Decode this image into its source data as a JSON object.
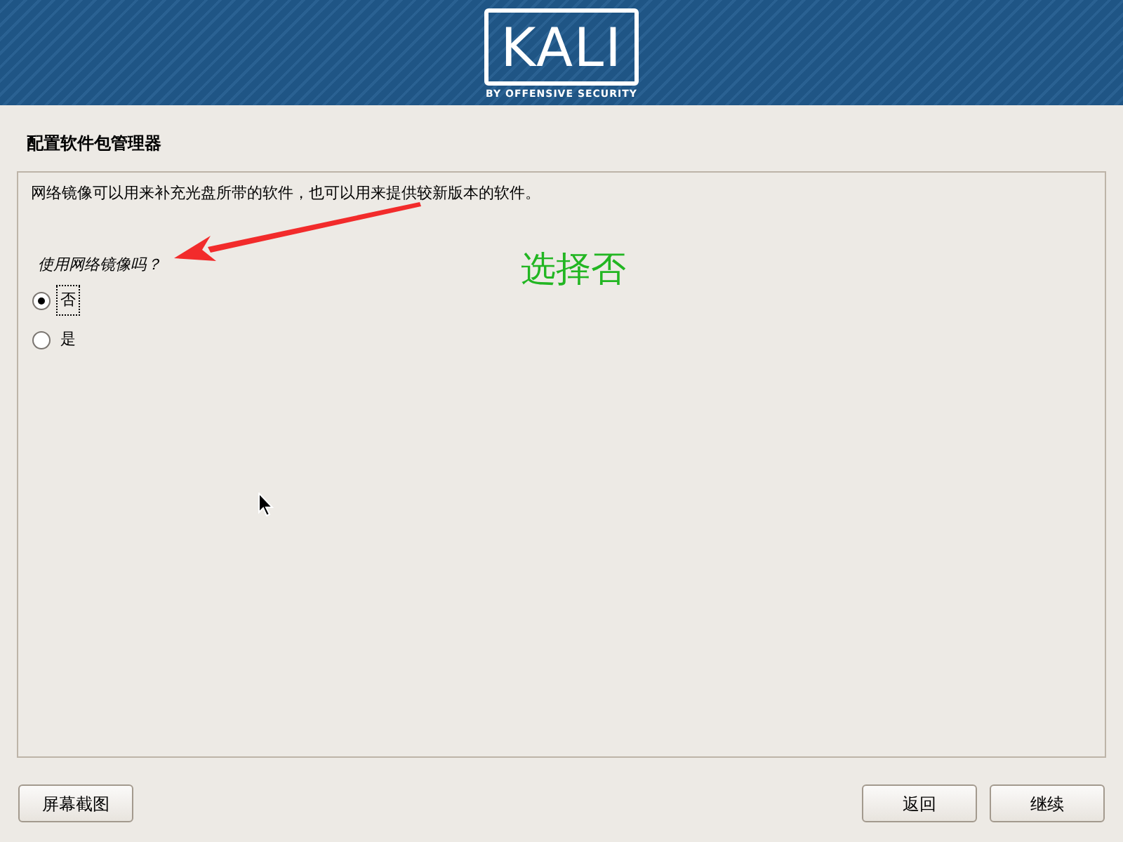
{
  "banner": {
    "logo": {
      "title": "KALI",
      "tagline": "BY OFFENSIVE SECURITY"
    }
  },
  "page_title": "配置软件包管理器",
  "panel": {
    "description": "网络镜像可以用来补充光盘所带的软件，也可以用来提供较新版本的软件。",
    "question": "使用网络镜像吗？",
    "options": [
      {
        "label": "否",
        "selected": true,
        "focused": true
      },
      {
        "label": "是",
        "selected": false,
        "focused": false
      }
    ]
  },
  "annotation": {
    "text": "选择否"
  },
  "buttons": {
    "left": [
      {
        "label": "屏幕截图"
      }
    ],
    "right": [
      {
        "label": "返回"
      },
      {
        "label": "继续"
      }
    ]
  }
}
